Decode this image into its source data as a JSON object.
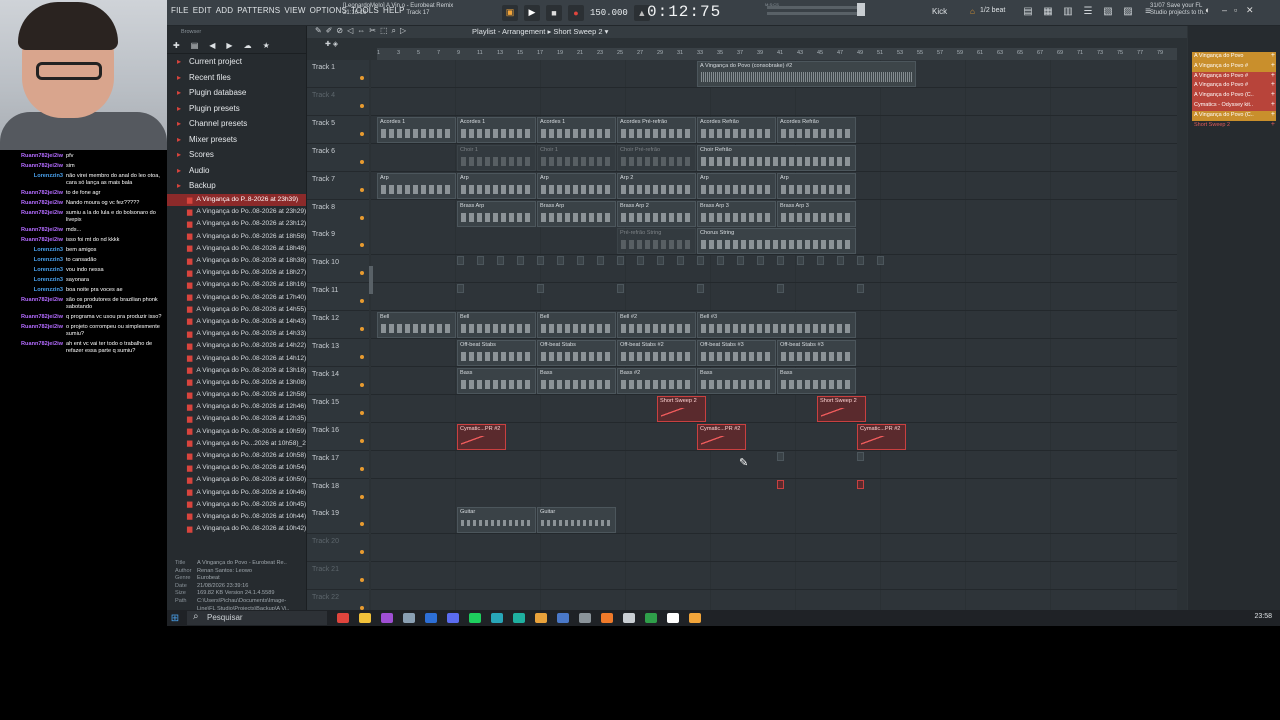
{
  "menu": [
    "FILE",
    "EDIT",
    "ADD",
    "PATTERNS",
    "VIEW",
    "OPTIONS",
    "TOOLS",
    "HELP"
  ],
  "song": {
    "line1": "[LeonardoMelo] A Vin.o - Eurobeat Remix",
    "line2": "21:16:16",
    "line3": "Track 17"
  },
  "transport": {
    "tempo": "150.000",
    "time": "0:12",
    "time_small": "75",
    "time_sub": "M:S:CS"
  },
  "channel": {
    "name": "Kick",
    "snap": "1/2 beat"
  },
  "hint": {
    "line1": "31/07 Save your FL",
    "line2": "Studio projects to th.."
  },
  "browser": {
    "header": "Browser",
    "items": [
      {
        "label": "Current project",
        "icon": "folder-icon"
      },
      {
        "label": "Recent files",
        "icon": "folder-icon"
      },
      {
        "label": "Plugin database",
        "icon": "folder-icon"
      },
      {
        "label": "Plugin presets",
        "icon": "folder-icon"
      },
      {
        "label": "Channel presets",
        "icon": "folder-icon"
      },
      {
        "label": "Mixer presets",
        "icon": "folder-icon"
      },
      {
        "label": "Scores",
        "icon": "folder-icon"
      },
      {
        "label": "Audio",
        "icon": "folder-icon"
      },
      {
        "label": "Backup",
        "icon": "folder-icon"
      }
    ],
    "files": [
      "A Vingança do P..8-2026 at 23h39)",
      "A Vingança do Po..08-2026 at 23h29)",
      "A Vingança do Po..08-2026 at 23h12)",
      "A Vingança do Po..08-2026 at 18h58)",
      "A Vingança do Po..08-2026 at 18h48)",
      "A Vingança do Po..08-2026 at 18h38)",
      "A Vingança do Po..08-2026 at 18h27)",
      "A Vingança do Po..08-2026 at 18h16)",
      "A Vingança do Po..08-2026 at 17h40)",
      "A Vingança do Po..08-2026 at 14h55)",
      "A Vingança do Po..08-2026 at 14h43)",
      "A Vingança do Po..08-2026 at 14h33)",
      "A Vingança do Po..08-2026 at 14h22)",
      "A Vingança do Po..08-2026 at 14h12)",
      "A Vingança do Po..08-2026 at 13h18)",
      "A Vingança do Po..08-2026 at 13h08)",
      "A Vingança do Po..08-2026 at 12h58)",
      "A Vingança do Po..08-2026 at 12h46)",
      "A Vingança do Po..08-2026 at 12h35)",
      "A Vingança do Po..08-2026 at 10h59)",
      "A Vingança do Po...2026 at 10h58)_2",
      "A Vingança do Po..08-2026 at 10h58)",
      "A Vingança do Po..08-2026 at 10h54)",
      "A Vingança do Po..08-2026 at 10h50)",
      "A Vingança do Po..08-2026 at 10h46)",
      "A Vingança do Po..08-2026 at 10h45)",
      "A Vingança do Po..08-2026 at 10h44)",
      "A Vingança do Po..08-2026 at 10h42)"
    ],
    "meta": {
      "title": "A Vingança do Povo - Eurobeat Re..",
      "author": "Renan Santos: Leowo",
      "genre": "Eurobeat",
      "date": "21/08/2026 23:39:16",
      "size": "169.82 KB",
      "version": "Version 24.1.4.5589",
      "path1": "C:\\Users\\Pichau\\Documents\\Image-",
      "path2": "Line\\FL Studio\\Projects\\Backup\\A Vi.."
    },
    "tags": "TAGS"
  },
  "playlist": {
    "title": "Playlist - Arrangement",
    "pattern": "Short Sweep 2"
  },
  "ruler": [
    "1",
    "3",
    "5",
    "7",
    "9",
    "11",
    "13",
    "15",
    "17",
    "19",
    "21",
    "23",
    "25",
    "27",
    "29",
    "31",
    "33",
    "35",
    "37",
    "39",
    "41",
    "43",
    "45",
    "47",
    "49",
    "51",
    "53",
    "55",
    "57",
    "59",
    "61",
    "63",
    "65",
    "67",
    "69",
    "71",
    "73",
    "75",
    "77",
    "79"
  ],
  "tracks": [
    {
      "name": "Track 1",
      "dim": false
    },
    {
      "name": "Track 4",
      "dim": true
    },
    {
      "name": "Track 5",
      "dim": false
    },
    {
      "name": "Track 6",
      "dim": false
    },
    {
      "name": "Track 7",
      "dim": false
    },
    {
      "name": "Track 8",
      "dim": false
    },
    {
      "name": "Track 9",
      "dim": false
    },
    {
      "name": "Track 10",
      "dim": false
    },
    {
      "name": "Track 11",
      "dim": false
    },
    {
      "name": "Track 12",
      "dim": false
    },
    {
      "name": "Track 13",
      "dim": false
    },
    {
      "name": "Track 14",
      "dim": false
    },
    {
      "name": "Track 15",
      "dim": false
    },
    {
      "name": "Track 16",
      "dim": false
    },
    {
      "name": "Track 17",
      "dim": false
    },
    {
      "name": "Track 18",
      "dim": false
    },
    {
      "name": "Track 19",
      "dim": false
    },
    {
      "name": "Track 20",
      "dim": true
    },
    {
      "name": "Track 21",
      "dim": true
    },
    {
      "name": "Track 22",
      "dim": true
    }
  ],
  "clips": [
    {
      "track": 0,
      "label": "A Vingança do Povo (consobrake) #2",
      "bar": 33,
      "len": 22,
      "kind": "audio"
    },
    {
      "track": 2,
      "label": "Acordes 1",
      "bar": 1,
      "len": 8,
      "kind": "normal"
    },
    {
      "track": 2,
      "label": "Acordes 1",
      "bar": 9,
      "len": 8,
      "kind": "normal"
    },
    {
      "track": 2,
      "label": "Acordes 1",
      "bar": 17,
      "len": 8,
      "kind": "normal"
    },
    {
      "track": 2,
      "label": "Acordes Pré-refrão",
      "bar": 25,
      "len": 8,
      "kind": "normal"
    },
    {
      "track": 2,
      "label": "Acordes Refrão",
      "bar": 33,
      "len": 8,
      "kind": "normal"
    },
    {
      "track": 2,
      "label": "Acordes Refrão",
      "bar": 41,
      "len": 8,
      "kind": "normal"
    },
    {
      "track": 3,
      "label": "Choir 1",
      "bar": 9,
      "len": 8,
      "kind": "ghost"
    },
    {
      "track": 3,
      "label": "Choir 1",
      "bar": 17,
      "len": 8,
      "kind": "ghost"
    },
    {
      "track": 3,
      "label": "Choir Pré-refrão",
      "bar": 25,
      "len": 8,
      "kind": "ghost"
    },
    {
      "track": 3,
      "label": "Choir Refrão",
      "bar": 33,
      "len": 16,
      "kind": "normal"
    },
    {
      "track": 4,
      "label": "Arp",
      "bar": 1,
      "len": 8,
      "kind": "normal"
    },
    {
      "track": 4,
      "label": "Arp",
      "bar": 9,
      "len": 8,
      "kind": "normal"
    },
    {
      "track": 4,
      "label": "Arp",
      "bar": 17,
      "len": 8,
      "kind": "normal"
    },
    {
      "track": 4,
      "label": "Arp 2",
      "bar": 25,
      "len": 8,
      "kind": "normal"
    },
    {
      "track": 4,
      "label": "Arp",
      "bar": 33,
      "len": 8,
      "kind": "normal"
    },
    {
      "track": 4,
      "label": "Arp",
      "bar": 41,
      "len": 8,
      "kind": "normal"
    },
    {
      "track": 5,
      "label": "Brass Arp",
      "bar": 9,
      "len": 8,
      "kind": "normal"
    },
    {
      "track": 5,
      "label": "Brass Arp",
      "bar": 17,
      "len": 8,
      "kind": "normal"
    },
    {
      "track": 5,
      "label": "Brass Arp 2",
      "bar": 25,
      "len": 8,
      "kind": "normal"
    },
    {
      "track": 5,
      "label": "Brass Arp 3",
      "bar": 33,
      "len": 8,
      "kind": "normal"
    },
    {
      "track": 5,
      "label": "Brass Arp 3",
      "bar": 41,
      "len": 8,
      "kind": "normal"
    },
    {
      "track": 6,
      "label": "Pré-refrão String",
      "bar": 25,
      "len": 8,
      "kind": "ghost"
    },
    {
      "track": 6,
      "label": "Chorus String",
      "bar": 33,
      "len": 16,
      "kind": "normal"
    },
    {
      "track": 9,
      "label": "Bell",
      "bar": 1,
      "len": 8,
      "kind": "normal"
    },
    {
      "track": 9,
      "label": "Bell",
      "bar": 9,
      "len": 8,
      "kind": "normal"
    },
    {
      "track": 9,
      "label": "Bell",
      "bar": 17,
      "len": 8,
      "kind": "normal"
    },
    {
      "track": 9,
      "label": "Bell #2",
      "bar": 25,
      "len": 8,
      "kind": "normal"
    },
    {
      "track": 9,
      "label": "Bell #3",
      "bar": 33,
      "len": 16,
      "kind": "normal"
    },
    {
      "track": 10,
      "label": "Off-beat Stabs",
      "bar": 9,
      "len": 8,
      "kind": "normal"
    },
    {
      "track": 10,
      "label": "Off-beat Stabs",
      "bar": 17,
      "len": 8,
      "kind": "normal"
    },
    {
      "track": 10,
      "label": "Off-beat Stabs #2",
      "bar": 25,
      "len": 8,
      "kind": "normal"
    },
    {
      "track": 10,
      "label": "Off-beat Stabs #3",
      "bar": 33,
      "len": 8,
      "kind": "normal"
    },
    {
      "track": 10,
      "label": "Off-beat Stabs #3",
      "bar": 41,
      "len": 8,
      "kind": "normal"
    },
    {
      "track": 11,
      "label": "Bass",
      "bar": 9,
      "len": 8,
      "kind": "normal"
    },
    {
      "track": 11,
      "label": "Bass",
      "bar": 17,
      "len": 8,
      "kind": "normal"
    },
    {
      "track": 11,
      "label": "Bass #2",
      "bar": 25,
      "len": 8,
      "kind": "normal"
    },
    {
      "track": 11,
      "label": "Bass",
      "bar": 33,
      "len": 8,
      "kind": "normal"
    },
    {
      "track": 11,
      "label": "Bass",
      "bar": 41,
      "len": 8,
      "kind": "normal"
    },
    {
      "track": 12,
      "label": "Short Sweep 2",
      "bar": 29,
      "len": 5,
      "kind": "red"
    },
    {
      "track": 12,
      "label": "Short Sweep 2",
      "bar": 45,
      "len": 5,
      "kind": "red"
    },
    {
      "track": 13,
      "label": "Cymatic...PR #2",
      "bar": 9,
      "len": 5,
      "kind": "red"
    },
    {
      "track": 13,
      "label": "Cymatic...PR #2",
      "bar": 33,
      "len": 5,
      "kind": "red"
    },
    {
      "track": 13,
      "label": "Cymatic...PR #2",
      "bar": 49,
      "len": 5,
      "kind": "red"
    },
    {
      "track": 16,
      "label": "Guitar",
      "bar": 9,
      "len": 8,
      "kind": "guitar"
    },
    {
      "track": 16,
      "label": "Guitar",
      "bar": 17,
      "len": 8,
      "kind": "guitar"
    }
  ],
  "picker": [
    {
      "label": "A Vingança do Povo",
      "color": "#c98f2c"
    },
    {
      "label": "A Vingança do Povo #",
      "color": "#c98f2c"
    },
    {
      "label": "A Vingança do Povo #",
      "color": "#b8443a"
    },
    {
      "label": "A Vingança do Povo #",
      "color": "#b8443a"
    },
    {
      "label": "A Vingança do Povo (C..",
      "color": "#b8443a"
    },
    {
      "label": "Cymatics - Odyssey kit..",
      "color": "#b8443a"
    },
    {
      "label": "A Vingança do Povo (C..",
      "color": "#c98f2c"
    },
    {
      "label": "Short Sweep 2",
      "color": "#262b2f"
    }
  ],
  "chat": [
    {
      "user": "Ruann782jei2iw",
      "text": "pfv"
    },
    {
      "user": "Ruann782jei2iw",
      "text": "sim"
    },
    {
      "user": "Lorenzzin3",
      "text": "não virei membro do anal do leo otoa, cara só lança as mais bala"
    },
    {
      "user": "Ruann782jei2iw",
      "text": "to de fone agr"
    },
    {
      "user": "Ruann782jei2iw",
      "text": "Nando moura og vc fez?????"
    },
    {
      "user": "Ruann782jei2iw",
      "text": "sumiu a la do lula e do bolsonaro do livepix"
    },
    {
      "user": "Ruann782jei2iw",
      "text": "mds..."
    },
    {
      "user": "Ruann782jei2iw",
      "text": "isso foi mt do nd kkkk"
    },
    {
      "user": "Lorenzzin3",
      "text": "bem amigos"
    },
    {
      "user": "Lorenzzin3",
      "text": "to cansadão"
    },
    {
      "user": "Lorenzzin3",
      "text": "vou indo nessa"
    },
    {
      "user": "Lorenzzin3",
      "text": "sayonara"
    },
    {
      "user": "Lorenzzin3",
      "text": "boa noite pra voces ae"
    },
    {
      "user": "Ruann782jei2iw",
      "text": "são os produtores de brazilian phonk sabotando"
    },
    {
      "user": "Ruann782jei2iw",
      "text": "q programa vc usou pra produzir isso?"
    },
    {
      "user": "Ruann782jei2iw",
      "text": "o projeto corrompeu ou simplesmente sumiu?"
    },
    {
      "user": "Ruann782jei2iw",
      "text": "ah ent vc vai ter todo o trabalho de refazer essa parte q sumiu?"
    }
  ],
  "taskbar": {
    "search": "Pesquisar",
    "clock": "23:58"
  },
  "colors": {
    "accent": "#e89b2f",
    "red_clip": "#c94040",
    "selected": "#8c2a2a"
  }
}
